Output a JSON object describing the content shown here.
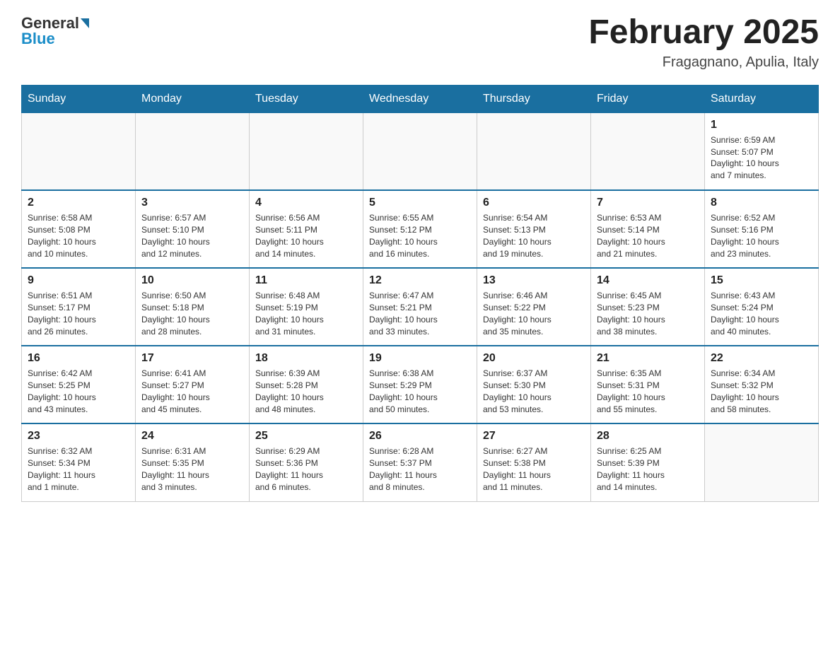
{
  "header": {
    "logo_general": "General",
    "logo_blue": "Blue",
    "month_title": "February 2025",
    "location": "Fragagnano, Apulia, Italy"
  },
  "weekdays": [
    "Sunday",
    "Monday",
    "Tuesday",
    "Wednesday",
    "Thursday",
    "Friday",
    "Saturday"
  ],
  "weeks": [
    [
      {
        "day": "",
        "info": ""
      },
      {
        "day": "",
        "info": ""
      },
      {
        "day": "",
        "info": ""
      },
      {
        "day": "",
        "info": ""
      },
      {
        "day": "",
        "info": ""
      },
      {
        "day": "",
        "info": ""
      },
      {
        "day": "1",
        "info": "Sunrise: 6:59 AM\nSunset: 5:07 PM\nDaylight: 10 hours\nand 7 minutes."
      }
    ],
    [
      {
        "day": "2",
        "info": "Sunrise: 6:58 AM\nSunset: 5:08 PM\nDaylight: 10 hours\nand 10 minutes."
      },
      {
        "day": "3",
        "info": "Sunrise: 6:57 AM\nSunset: 5:10 PM\nDaylight: 10 hours\nand 12 minutes."
      },
      {
        "day": "4",
        "info": "Sunrise: 6:56 AM\nSunset: 5:11 PM\nDaylight: 10 hours\nand 14 minutes."
      },
      {
        "day": "5",
        "info": "Sunrise: 6:55 AM\nSunset: 5:12 PM\nDaylight: 10 hours\nand 16 minutes."
      },
      {
        "day": "6",
        "info": "Sunrise: 6:54 AM\nSunset: 5:13 PM\nDaylight: 10 hours\nand 19 minutes."
      },
      {
        "day": "7",
        "info": "Sunrise: 6:53 AM\nSunset: 5:14 PM\nDaylight: 10 hours\nand 21 minutes."
      },
      {
        "day": "8",
        "info": "Sunrise: 6:52 AM\nSunset: 5:16 PM\nDaylight: 10 hours\nand 23 minutes."
      }
    ],
    [
      {
        "day": "9",
        "info": "Sunrise: 6:51 AM\nSunset: 5:17 PM\nDaylight: 10 hours\nand 26 minutes."
      },
      {
        "day": "10",
        "info": "Sunrise: 6:50 AM\nSunset: 5:18 PM\nDaylight: 10 hours\nand 28 minutes."
      },
      {
        "day": "11",
        "info": "Sunrise: 6:48 AM\nSunset: 5:19 PM\nDaylight: 10 hours\nand 31 minutes."
      },
      {
        "day": "12",
        "info": "Sunrise: 6:47 AM\nSunset: 5:21 PM\nDaylight: 10 hours\nand 33 minutes."
      },
      {
        "day": "13",
        "info": "Sunrise: 6:46 AM\nSunset: 5:22 PM\nDaylight: 10 hours\nand 35 minutes."
      },
      {
        "day": "14",
        "info": "Sunrise: 6:45 AM\nSunset: 5:23 PM\nDaylight: 10 hours\nand 38 minutes."
      },
      {
        "day": "15",
        "info": "Sunrise: 6:43 AM\nSunset: 5:24 PM\nDaylight: 10 hours\nand 40 minutes."
      }
    ],
    [
      {
        "day": "16",
        "info": "Sunrise: 6:42 AM\nSunset: 5:25 PM\nDaylight: 10 hours\nand 43 minutes."
      },
      {
        "day": "17",
        "info": "Sunrise: 6:41 AM\nSunset: 5:27 PM\nDaylight: 10 hours\nand 45 minutes."
      },
      {
        "day": "18",
        "info": "Sunrise: 6:39 AM\nSunset: 5:28 PM\nDaylight: 10 hours\nand 48 minutes."
      },
      {
        "day": "19",
        "info": "Sunrise: 6:38 AM\nSunset: 5:29 PM\nDaylight: 10 hours\nand 50 minutes."
      },
      {
        "day": "20",
        "info": "Sunrise: 6:37 AM\nSunset: 5:30 PM\nDaylight: 10 hours\nand 53 minutes."
      },
      {
        "day": "21",
        "info": "Sunrise: 6:35 AM\nSunset: 5:31 PM\nDaylight: 10 hours\nand 55 minutes."
      },
      {
        "day": "22",
        "info": "Sunrise: 6:34 AM\nSunset: 5:32 PM\nDaylight: 10 hours\nand 58 minutes."
      }
    ],
    [
      {
        "day": "23",
        "info": "Sunrise: 6:32 AM\nSunset: 5:34 PM\nDaylight: 11 hours\nand 1 minute."
      },
      {
        "day": "24",
        "info": "Sunrise: 6:31 AM\nSunset: 5:35 PM\nDaylight: 11 hours\nand 3 minutes."
      },
      {
        "day": "25",
        "info": "Sunrise: 6:29 AM\nSunset: 5:36 PM\nDaylight: 11 hours\nand 6 minutes."
      },
      {
        "day": "26",
        "info": "Sunrise: 6:28 AM\nSunset: 5:37 PM\nDaylight: 11 hours\nand 8 minutes."
      },
      {
        "day": "27",
        "info": "Sunrise: 6:27 AM\nSunset: 5:38 PM\nDaylight: 11 hours\nand 11 minutes."
      },
      {
        "day": "28",
        "info": "Sunrise: 6:25 AM\nSunset: 5:39 PM\nDaylight: 11 hours\nand 14 minutes."
      },
      {
        "day": "",
        "info": ""
      }
    ]
  ]
}
